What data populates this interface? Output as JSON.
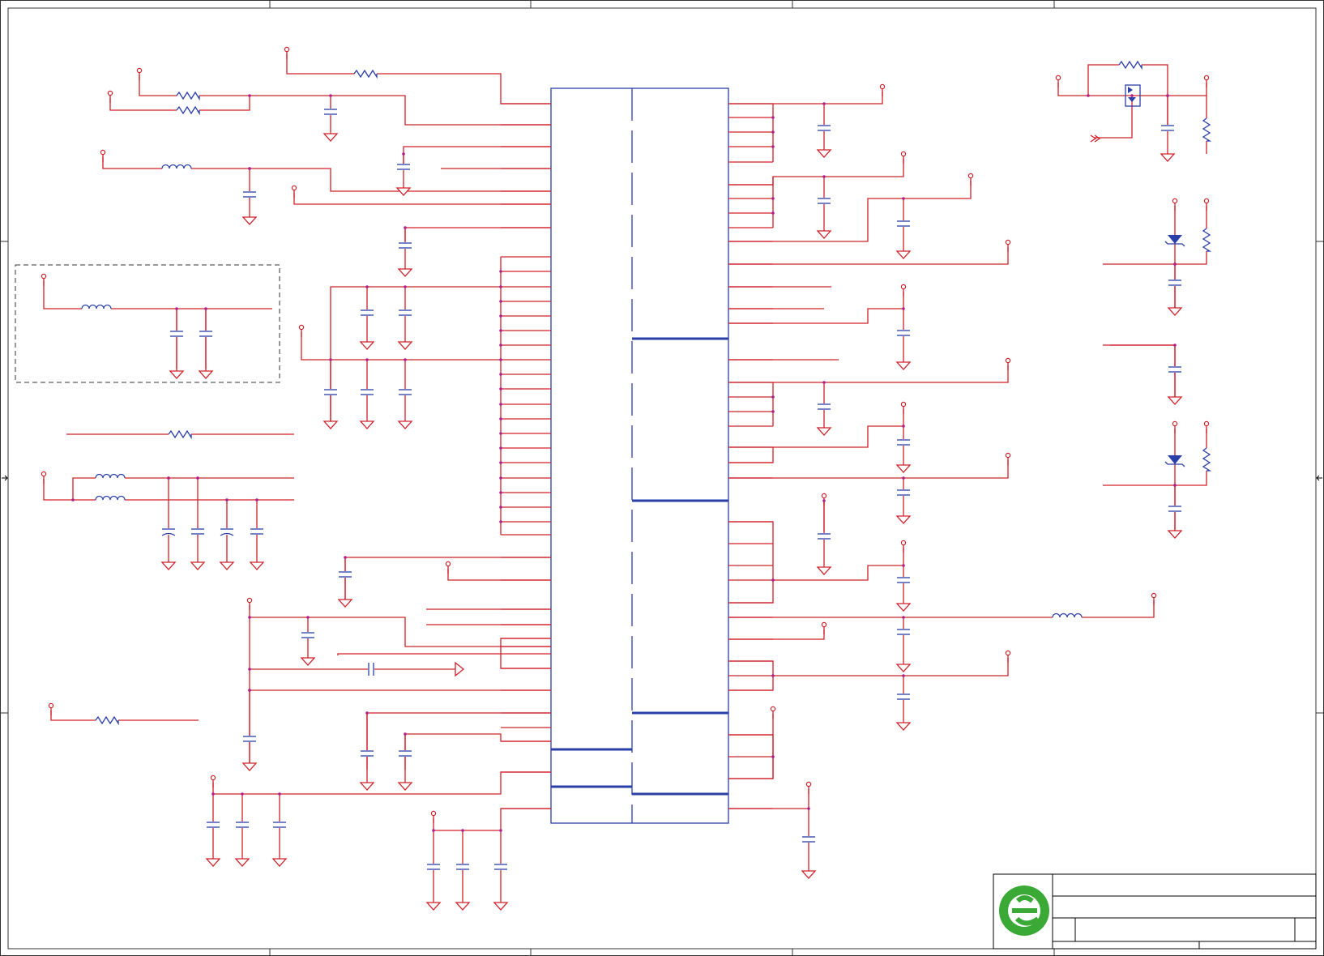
{
  "sheet": {
    "title": "",
    "company_logo": "green-e-logo-icon",
    "colors": {
      "wire": "#d0202a",
      "symbol": "#2b3fa8",
      "junction": "#b0208a",
      "frame": "#333333",
      "logo": "#3aa935"
    }
  }
}
